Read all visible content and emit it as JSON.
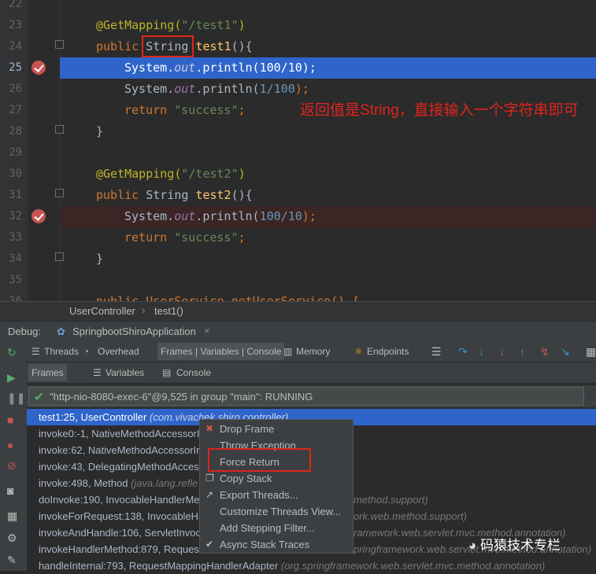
{
  "editor": {
    "line_numbers": [
      "22",
      "23",
      "24",
      "25",
      "26",
      "27",
      "28",
      "29",
      "30",
      "31",
      "32",
      "33",
      "34",
      "35",
      "36"
    ],
    "note": "返回值是String，直接输入一个字符串即可",
    "lines": {
      "l23_ann": "@GetMapping(",
      "l23_str": "\"/test1\"",
      "l23_end": ")",
      "l24_kw": "public ",
      "l24_type": "String",
      "l24_fn": "test1",
      "l24_end": "(){",
      "l25_a": "System.",
      "l25_b": "out",
      "l25_c": ".println(",
      "l25_d": "100/10",
      "l25_e": ");",
      "l26_a": "System.",
      "l26_b": "out",
      "l26_c": ".println(",
      "l26_d": "1/100",
      "l26_e": ");",
      "l27_kw": "return ",
      "l27_str": "\"success\"",
      "l27_end": ";",
      "l28": "}",
      "l30_ann": "@GetMapping(",
      "l30_str": "\"/test2\"",
      "l30_end": ")",
      "l31_kw": "public ",
      "l31_type": "String ",
      "l31_fn": "test2",
      "l31_end": "(){",
      "l32_a": "System.",
      "l32_b": "out",
      "l32_c": ".println(",
      "l32_d": "100/10",
      "l32_e": ");",
      "l33_kw": "return ",
      "l33_str": "\"success\"",
      "l33_end": ";",
      "l34": "}",
      "l36": "public UserService getUserService() {"
    }
  },
  "breadcrumb": [
    "UserController",
    "test1()"
  ],
  "debug": {
    "label": "Debug:",
    "config": "SpringbootShiroApplication",
    "tabs": [
      "Threads",
      "Overhead",
      "Frames | Variables | Console",
      "Memory",
      "Endpoints"
    ],
    "subtabs": [
      "Frames",
      "Variables",
      "Console"
    ],
    "thread": "\"http-nio-8080-exec-6\"@9,525 in group \"main\": RUNNING"
  },
  "frames": [
    {
      "m": "test1:25, UserController",
      "p": "(com.vivachek.shiro.controller)"
    },
    {
      "m": "invoke0:-1, NativeMethodAccessorI",
      "p": ""
    },
    {
      "m": "invoke:62, NativeMethodAccessorIr",
      "p": ""
    },
    {
      "m": "invoke:43, DelegatingMethodAcces",
      "p": ""
    },
    {
      "m": "invoke:498, Method",
      "p": "(java.lang.refle"
    },
    {
      "m": "doInvoke:190, InvocableHandlerMe",
      "p": "method.support)"
    },
    {
      "m": "invokeForRequest:138, InvocableHa",
      "p": "ork.web.method.support)"
    },
    {
      "m": "invokeAndHandle:106, ServletInvoca",
      "p": "ramework.web.servlet.mvc.method.annotation)"
    },
    {
      "m": "invokeHandlerMethod:879, Request",
      "p": "pringframework.web.servlet.mvc.method.annotation)"
    },
    {
      "m": "handleInternal:793, RequestMappingHandlerAdapter",
      "p": "(org.springframework.web.servlet.mvc.method.annotation)"
    }
  ],
  "menu": [
    "Drop Frame",
    "Throw Exception",
    "Force Return",
    "Copy Stack",
    "Export Threads...",
    "Customize Threads View...",
    "Add Stepping Filter...",
    "Async Stack Traces"
  ],
  "watermark": "码猿技术专栏",
  "colors": {
    "selection": "#2f65ca",
    "annotation_red": "#e0241c",
    "breakpoint": "#c75450"
  }
}
